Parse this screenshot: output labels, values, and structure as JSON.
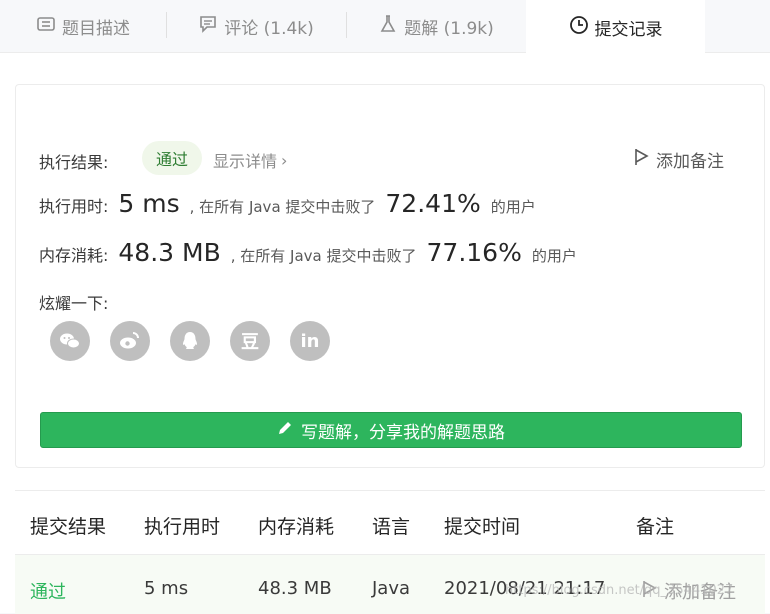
{
  "tabs": [
    {
      "label": "题目描述",
      "icon": "document-icon"
    },
    {
      "label": "评论 (1.4k)",
      "icon": "comment-icon"
    },
    {
      "label": "题解 (1.9k)",
      "icon": "flask-icon"
    },
    {
      "label": "提交记录",
      "icon": "clock-icon"
    }
  ],
  "result": {
    "label": "执行结果:",
    "status": "通过",
    "detail_link": "显示详情",
    "add_note": "添加备注"
  },
  "runtime": {
    "label": "执行用时:",
    "value": "5 ms",
    "text": ", 在所有 Java 提交中击败了",
    "percent": "72.41%",
    "suffix": "的用户"
  },
  "memory": {
    "label": "内存消耗:",
    "value": "48.3 MB",
    "text": ", 在所有 Java 提交中击败了",
    "percent": "77.16%",
    "suffix": "的用户"
  },
  "share": {
    "label": "炫耀一下:",
    "icons": [
      "wechat-icon",
      "weibo-icon",
      "qq-icon",
      "douban-icon",
      "linkedin-icon"
    ],
    "douban_glyph": "豆",
    "linkedin_glyph": "in"
  },
  "write_button": "写题解，分享我的解题思路",
  "table": {
    "headers": [
      "提交结果",
      "执行用时",
      "内存消耗",
      "语言",
      "提交时间",
      "备注"
    ],
    "rows": [
      {
        "result": "通过",
        "runtime": "5 ms",
        "memory": "48.3 MB",
        "language": "Java",
        "time": "2021/08/21 21:17",
        "note": "添加备注"
      }
    ]
  },
  "watermark": "https://blog.csdn.net/qq_35441027",
  "colors": {
    "accent": "#2db55d",
    "pass_text": "#2db55d"
  }
}
